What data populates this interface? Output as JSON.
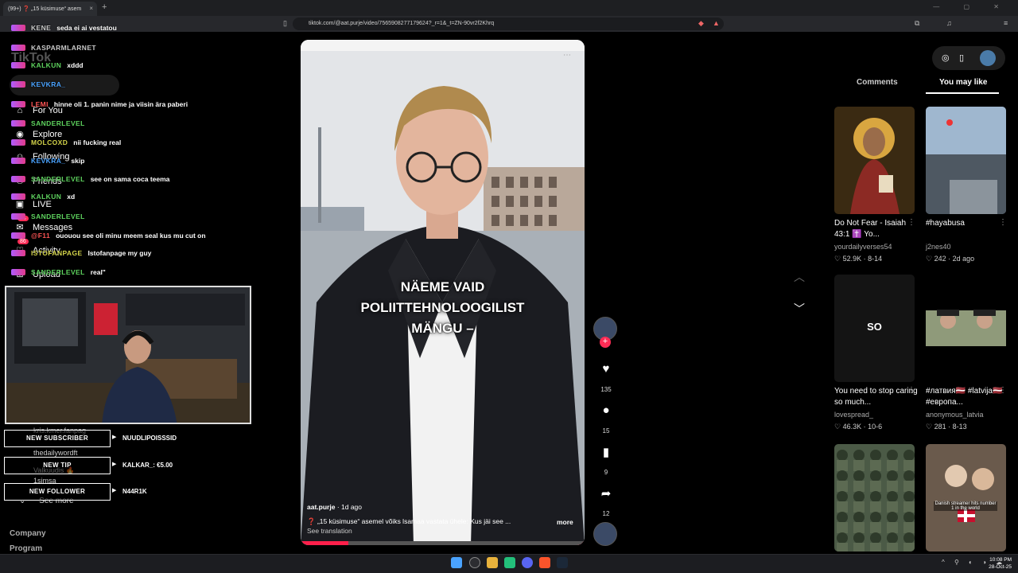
{
  "browser": {
    "tab_title": "(99+) ❓ „15 küsimuse“ asem",
    "url": "tiktok.com/@aat.purje/video/7565908277179624?_r=1&_t=ZN-90vr2f2Khrq",
    "new_tab": "+",
    "close": "×"
  },
  "sidebar": {
    "logo": "TikTok",
    "nav": [
      {
        "label": "For You",
        "icon": "home-icon"
      },
      {
        "label": "Explore",
        "icon": "compass-icon"
      },
      {
        "label": "Following",
        "icon": "following-icon"
      },
      {
        "label": "Friends",
        "icon": "friends-icon"
      },
      {
        "label": "LIVE",
        "icon": "live-icon"
      },
      {
        "label": "Messages",
        "icon": "messages-icon",
        "badge": "14"
      },
      {
        "label": "Activity",
        "icon": "activity-icon",
        "badge": "86"
      },
      {
        "label": "Upload",
        "icon": "upload-icon"
      }
    ],
    "following_accounts": [
      "kris.kmer.fanpag",
      "thedailywordft",
      "Valkuudis 🔥",
      "1simsa"
    ],
    "see_more": "See more",
    "footer": [
      "Company",
      "Program"
    ]
  },
  "chat": [
    {
      "user": "KENE",
      "msg": "seda ei ai vestatou",
      "color": "#c9c9c9"
    },
    {
      "user": "KASPARMLARNET",
      "msg": "",
      "color": "#c8c8c8"
    },
    {
      "user": "KALKUN",
      "msg": "xddd",
      "color": "#5ed35e"
    },
    {
      "user": "KEVKRA_",
      "msg": "",
      "color": "#4aa3ff"
    },
    {
      "user": "LEMI",
      "msg": "hinne oli 1. panin nime ja viisin ära paberi",
      "color": "#ff5555"
    },
    {
      "user": "SANDERLEVEL",
      "msg": "",
      "color": "#5ed35e"
    },
    {
      "user": "MOLCOXD",
      "msg": "nii fucking real",
      "color": "#d4d44a"
    },
    {
      "user": "KEVKRA_",
      "msg": "skip",
      "color": "#4aa3ff"
    },
    {
      "user": "SANDERLEVEL",
      "msg": "see on sama coca teema",
      "color": "#5ed35e"
    },
    {
      "user": "KALKUN",
      "msg": "xd",
      "color": "#5ed35e"
    },
    {
      "user": "SANDERLEVEL",
      "msg": "",
      "color": "#5ed35e"
    },
    {
      "user": "@F11",
      "msg": "ououou see oli minu meem seal kus mu cut on",
      "color": "#ff5555"
    },
    {
      "user": "ISTOFANPAGE",
      "msg": "Istofanpage my guy",
      "color": "#d4d44a"
    },
    {
      "user": "SANDERLEVEL",
      "msg": "real\"",
      "color": "#5ed35e"
    }
  ],
  "alerts": [
    {
      "label": "NEW SUBSCRIBER",
      "value": "NUUDLIPOISSSID"
    },
    {
      "label": "NEW TIP",
      "value": "KALKAR_: €5.00"
    },
    {
      "label": "NEW FOLLOWER",
      "value": "N44R1K"
    }
  ],
  "video": {
    "caption_lines": [
      "NÄEME VAID",
      "POLIITTEHNOLOOGILIST",
      "MÄNGU –"
    ],
    "author": "aat.purje",
    "age": "1d ago",
    "description": "❓ „15 küsimuse“ asemel võiks lsamaa vastata ühele: Kus jäi see ...",
    "more": "more",
    "see_translation": "See translation",
    "likes": "135",
    "comments": "15",
    "saves": "9",
    "shares": "12"
  },
  "right_panel": {
    "tabs": [
      "Comments",
      "You may like"
    ],
    "active_tab": "You may like",
    "cards": [
      {
        "title": "Do Not Fear - Isaiah 43:1 ✝️ Yo...",
        "author": "yourdailyverses54",
        "likes": "52.9K",
        "date": "8-14",
        "bg": "#3a2a12"
      },
      {
        "title": "#hayabusa",
        "author": "j2nes40",
        "likes": "242",
        "date": "2d ago",
        "bg": "#6c7d8e"
      },
      {
        "title": "You need to stop caring so much...",
        "author": "lovespread_",
        "likes": "46.3K",
        "date": "10-6",
        "bg": "#141414",
        "overlay": "SO"
      },
      {
        "title": "#латвия🇱🇻 #latvija🇱🇻 #европа...",
        "author": "anonymous_latvia",
        "likes": "281",
        "date": "8-13",
        "bg": "#000000"
      },
      {
        "title": "",
        "author": "",
        "likes": "",
        "date": "",
        "bg": "#4b5a46"
      },
      {
        "title": "",
        "author": "",
        "likes": "",
        "date": "",
        "bg": "#6a5a4c",
        "overlay": "Danish streamer hits number 1 in the world"
      }
    ]
  },
  "clock": {
    "time": "10:08 PM",
    "date": "28-Oct-25"
  }
}
